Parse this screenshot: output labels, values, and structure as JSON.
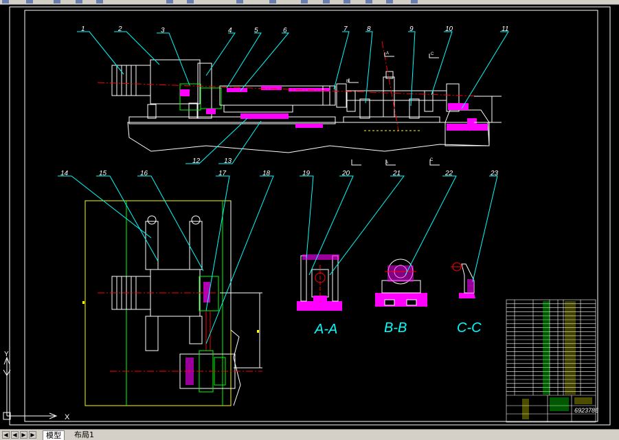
{
  "colors": {
    "background": "#000000",
    "frame": "#ffffff",
    "leader": "#00ffff",
    "outline": "#00ff00",
    "hatch": "#ff00ff",
    "centerline": "#ff0000",
    "body": "#ffffff",
    "section": "#ffff00"
  },
  "drawing": {
    "balloons": [
      "1",
      "2",
      "3",
      "4",
      "5",
      "6",
      "7",
      "8",
      "9",
      "10",
      "11",
      "12",
      "13",
      "14",
      "15",
      "16",
      "17",
      "18",
      "19",
      "20",
      "21",
      "22",
      "23"
    ],
    "section_views": {
      "aa": "A-A",
      "bb": "B-B",
      "cc": "C-C"
    },
    "cut_marks": {
      "a": "A",
      "b": "B",
      "c": "C"
    },
    "title_block": {
      "drawing_number": "6923786"
    }
  },
  "ucs": {
    "x": "X",
    "y": "Y"
  },
  "tabs": {
    "model": "模型",
    "layout1": "布局1"
  },
  "nav": {
    "first": "◀",
    "prev": "◀",
    "next": "▶",
    "last": "▶"
  }
}
